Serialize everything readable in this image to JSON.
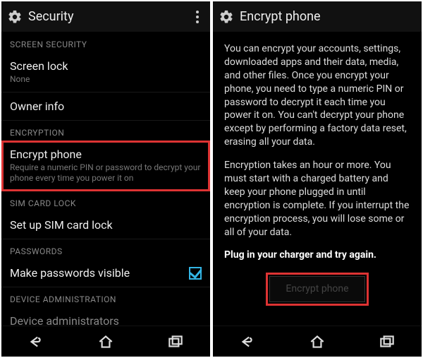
{
  "left": {
    "appbar_title": "Security",
    "sections": {
      "screen_security_header": "SCREEN SECURITY",
      "screen_lock_title": "Screen lock",
      "screen_lock_sub": "None",
      "owner_info_title": "Owner info",
      "encryption_header": "ENCRYPTION",
      "encrypt_phone_title": "Encrypt phone",
      "encrypt_phone_sub": "Require a numeric PIN or password to decrypt your phone every time you power it on",
      "sim_header": "SIM CARD LOCK",
      "sim_title": "Set up SIM card lock",
      "passwords_header": "PASSWORDS",
      "passwords_title": "Make passwords visible",
      "device_admin_header": "DEVICE ADMINISTRATION",
      "device_admin_title": "Device administrators"
    }
  },
  "right": {
    "appbar_title": "Encrypt phone",
    "para1": "You can encrypt your accounts, settings, downloaded apps and their data, media, and other files. Once you encrypt your phone, you need to type a numeric PIN or password to decrypt it each time you power it on. You can't decrypt your phone except by performing a factory data reset, erasing all your data.",
    "para2": "Encryption takes an hour or more. You must start with a charged battery and keep your phone plugged in until encryption is complete. If you interrupt the encryption process, you will lose some or all of your data.",
    "para3": "Plug in your charger and try again.",
    "button_label": "Encrypt phone"
  }
}
